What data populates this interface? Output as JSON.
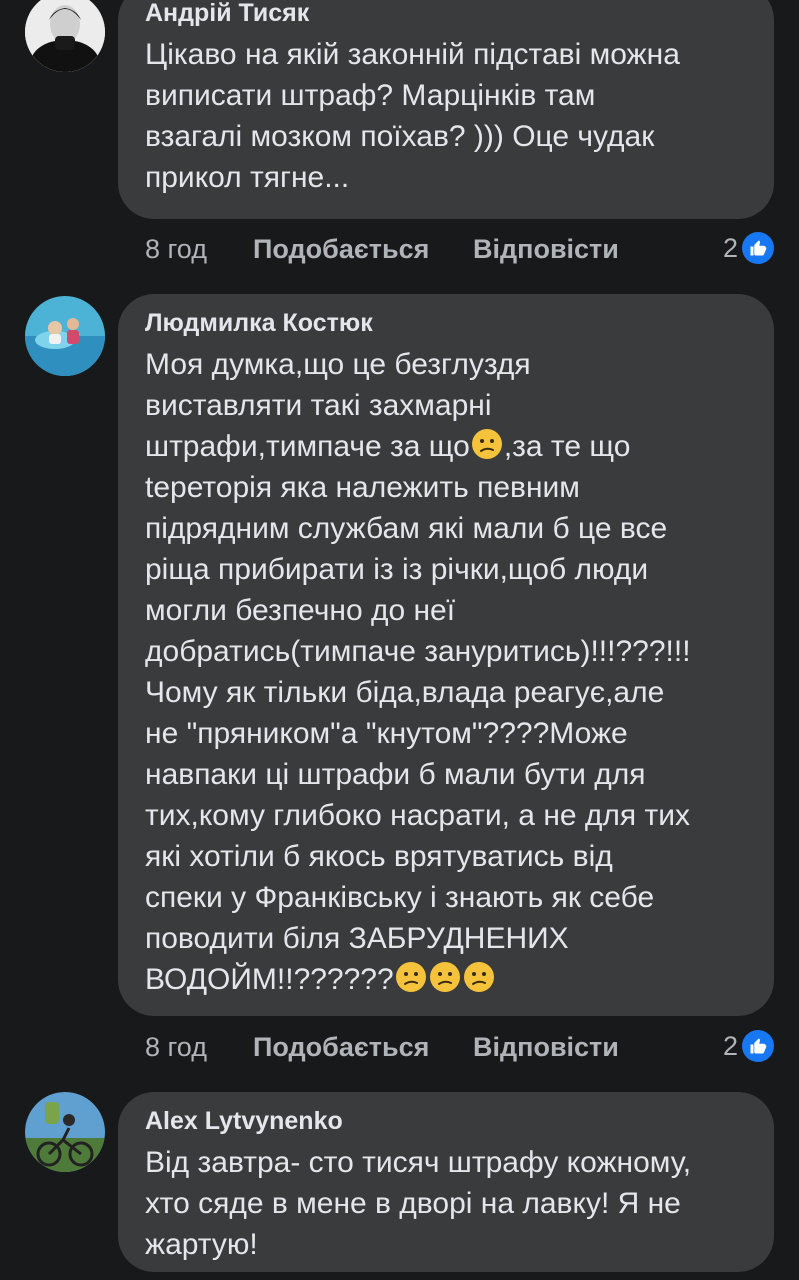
{
  "comments": [
    {
      "author": "Андрій Тисяк",
      "text": "Цікаво на якій законній підставі можна\nвиписати штраф? Марцінків там\nвзагалі мозком поїхав? ))) Оце чудак\nприкол тягне...",
      "time": "8 год",
      "like_label": "Подобається",
      "reply_label": "Відповісти",
      "reactions": "2"
    },
    {
      "author": "Людмилка Костюк",
      "text_parts": [
        "Моя думка,що це безглуздя\nвиставляти такі захмарні\nштрафи,тимпаче за що",
        ",за те що\ntереторія яка належить певним\nпідрядним службам які мали б це все\nріща прибирати із із річки,щоб люди\nмогли безпечно до неї\nдобратись(тимпаче зануритись)!!!???!!!\nЧому як тільки біда,влада реагує,але\nне \"пряником\"а \"кнутом\"????Може\nнавпаки ці штрафи б мали бути для\nтих,кому глибоко насрати, а не для тих\nякі хотіли б якось врятуватись від\nспеки у Франківську і знають як себе\nповодити біля ЗАБРУДНЕНИХ\nВОДОЙМ!!??????"
      ],
      "emoji_name": "confused-face",
      "time": "8 год",
      "like_label": "Подобається",
      "reply_label": "Відповісти",
      "reactions": "2"
    },
    {
      "author": "Alex Lytvynenko",
      "text": "Від завтра- сто тисяч штрафу кожному,\nхто сяде в мене в дворі на лавку! Я не\nжартую!"
    }
  ],
  "colors": {
    "background": "#18191a",
    "bubble": "#3a3b3c",
    "text": "#e4e6eb",
    "secondary": "#b0b3b8",
    "like_blue": "#1877f2"
  }
}
